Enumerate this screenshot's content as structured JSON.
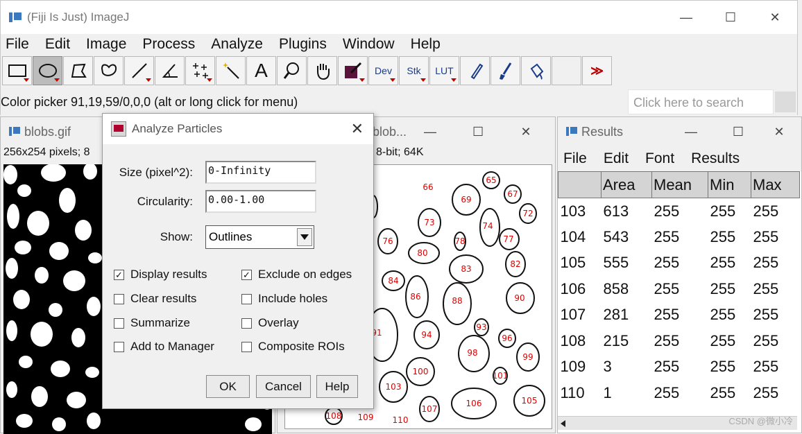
{
  "main": {
    "title": "(Fiji Is Just) ImageJ",
    "menu": [
      "File",
      "Edit",
      "Image",
      "Process",
      "Analyze",
      "Plugins",
      "Window",
      "Help"
    ],
    "tools": {
      "dev": "Dev",
      "stk": "Stk",
      "lut": "LUT",
      "more": "≫",
      "text_tool": "A"
    },
    "status": "Color picker 91,19,59/0,0,0 (alt or long click for menu)",
    "search_placeholder": "Click here to search"
  },
  "blobs_window": {
    "title": "blobs.gif",
    "info": "256x254 pixels; 8"
  },
  "outline_window": {
    "title": "blob...",
    "info": "8-bit; 64K",
    "labels": [
      "65",
      "66",
      "67",
      "69",
      "72",
      "73",
      "74",
      "76",
      "77",
      "78",
      "80",
      "82",
      "83",
      "84",
      "86",
      "88",
      "90",
      "91",
      "93",
      "94",
      "96",
      "98",
      "99",
      "100",
      "101",
      "103",
      "105",
      "106",
      "107",
      "108",
      "109",
      "110"
    ]
  },
  "results_window": {
    "title": "Results",
    "menu": [
      "File",
      "Edit",
      "Font",
      "Results"
    ],
    "columns": [
      "",
      "Area",
      "Mean",
      "Min",
      "Max"
    ],
    "rows": [
      [
        "103",
        "613",
        "255",
        "255",
        "255"
      ],
      [
        "104",
        "543",
        "255",
        "255",
        "255"
      ],
      [
        "105",
        "555",
        "255",
        "255",
        "255"
      ],
      [
        "106",
        "858",
        "255",
        "255",
        "255"
      ],
      [
        "107",
        "281",
        "255",
        "255",
        "255"
      ],
      [
        "108",
        "215",
        "255",
        "255",
        "255"
      ],
      [
        "109",
        "3",
        "255",
        "255",
        "255"
      ],
      [
        "110",
        "1",
        "255",
        "255",
        "255"
      ]
    ],
    "watermark": "CSDN @微小冷"
  },
  "dialog": {
    "title": "Analyze Particles",
    "size_label": "Size (pixel^2):",
    "size_value": "0-Infinity",
    "circ_label": "Circularity:",
    "circ_value": "0.00-1.00",
    "show_label": "Show:",
    "show_value": "Outlines",
    "checkboxes": {
      "display_results": {
        "label": "Display results",
        "checked": true
      },
      "exclude_edges": {
        "label": "Exclude on edges",
        "checked": true
      },
      "clear_results": {
        "label": "Clear results",
        "checked": false
      },
      "include_holes": {
        "label": "Include holes",
        "checked": false
      },
      "summarize": {
        "label": "Summarize",
        "checked": false
      },
      "overlay": {
        "label": "Overlay",
        "checked": false
      },
      "add_manager": {
        "label": "Add to Manager",
        "checked": false
      },
      "composite_rois": {
        "label": "Composite ROIs",
        "checked": false
      }
    },
    "ok": "OK",
    "cancel": "Cancel",
    "help": "Help"
  }
}
